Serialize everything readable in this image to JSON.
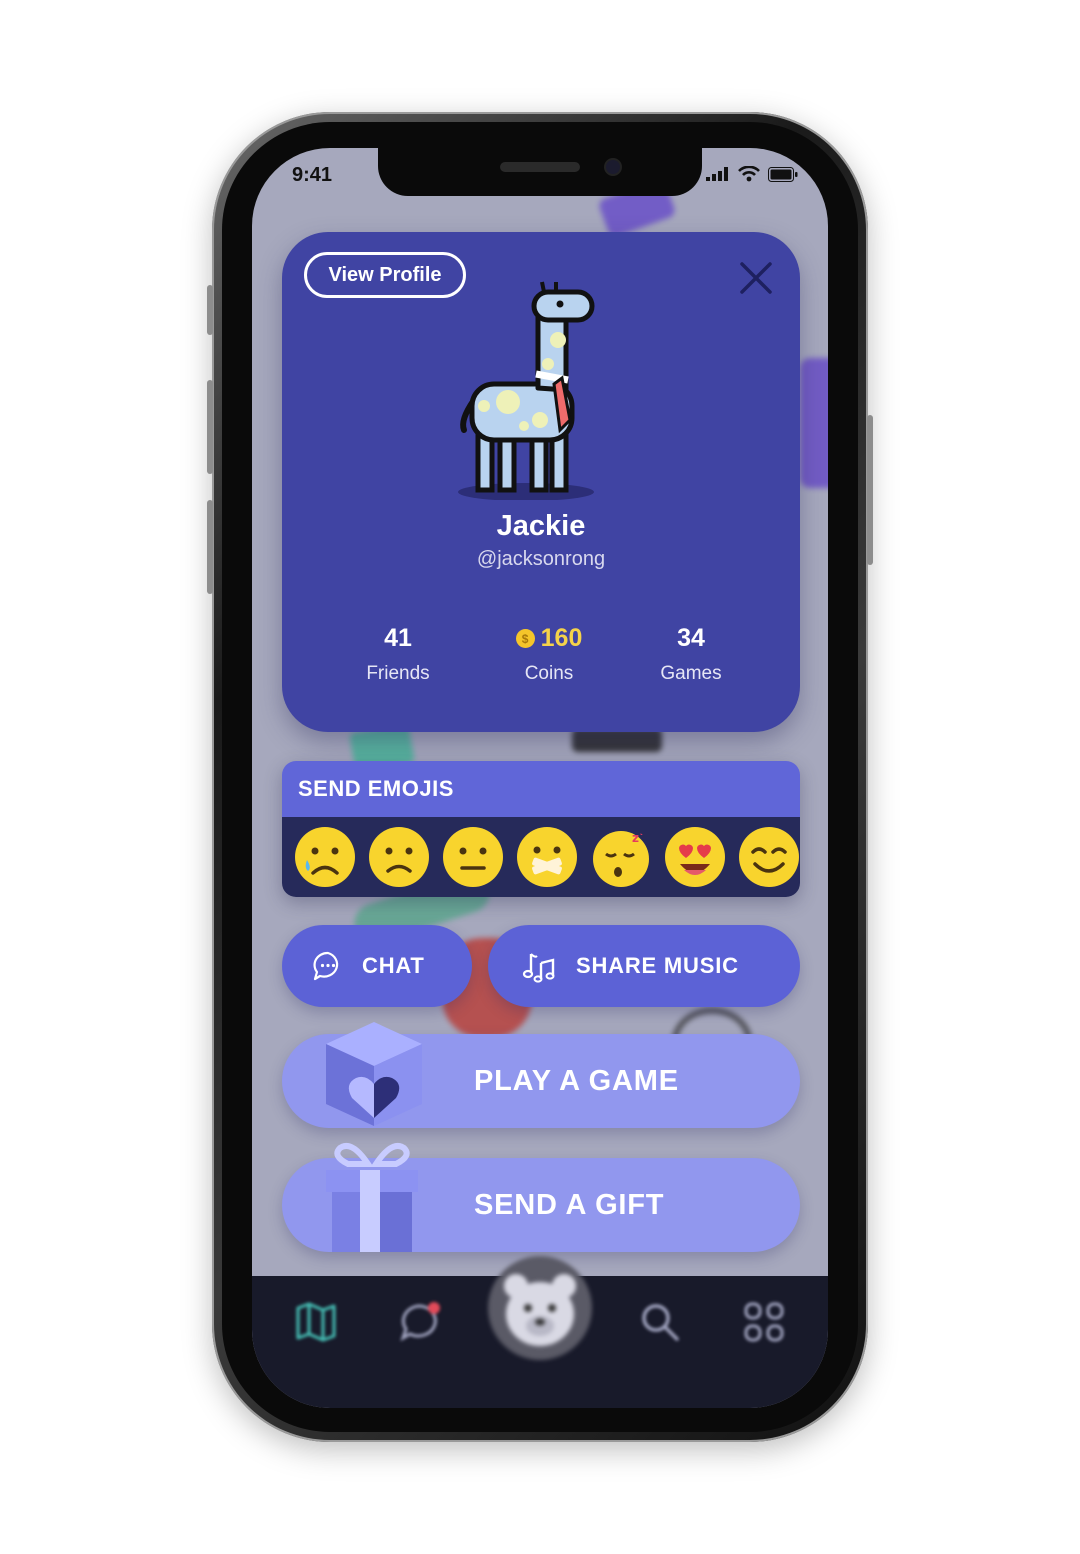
{
  "status_bar": {
    "time": "9:41"
  },
  "profile": {
    "view_profile_label": "View Profile",
    "name": "Jackie",
    "handle": "@jacksonrong",
    "stats": [
      {
        "value": "41",
        "label": "Friends"
      },
      {
        "value": "160",
        "label": "Coins"
      },
      {
        "value": "34",
        "label": "Games"
      }
    ],
    "coin_symbol": "$"
  },
  "emojis": {
    "title": "SEND EMOJIS",
    "items": [
      "crying-face",
      "frowning-face",
      "neutral-face",
      "mouth-taped-face",
      "sleeping-face",
      "heart-eyes-face",
      "smiling-face"
    ]
  },
  "actions": {
    "chat_label": "CHAT",
    "share_music_label": "SHARE MUSIC",
    "play_game_label": "PLAY A GAME",
    "send_gift_label": "SEND A GIFT"
  },
  "tab_bar": {
    "items": [
      "map-icon",
      "messages-icon",
      "bear-avatar",
      "search-icon",
      "apps-icon"
    ]
  },
  "colors": {
    "card": "#4044a3",
    "emoji_header": "#6066d8",
    "button_dark": "#5c62d6",
    "button_light": "#9197ee",
    "coin": "#f5c52a"
  }
}
